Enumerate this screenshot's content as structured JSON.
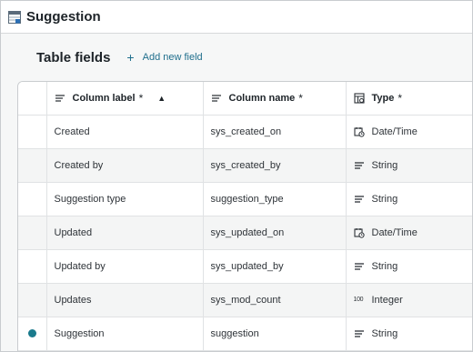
{
  "window": {
    "title": "Suggestion",
    "icon": "table-icon"
  },
  "section": {
    "heading": "Table fields",
    "add_label": "Add new field",
    "add_icon": "plus-icon"
  },
  "columns": {
    "label": {
      "text": "Column label",
      "required": "*",
      "sort": "▲"
    },
    "name": {
      "text": "Column name",
      "required": "*"
    },
    "type": {
      "text": "Type",
      "required": "*"
    }
  },
  "rows": [
    {
      "label": "Created",
      "name": "sys_created_on",
      "type": "Date/Time",
      "type_icon": "calendar-clock-icon",
      "marker": ""
    },
    {
      "label": "Created by",
      "name": "sys_created_by",
      "type": "String",
      "type_icon": "text-lines-icon",
      "marker": ""
    },
    {
      "label": "Suggestion type",
      "name": "suggestion_type",
      "type": "String",
      "type_icon": "text-lines-icon",
      "marker": ""
    },
    {
      "label": "Updated",
      "name": "sys_updated_on",
      "type": "Date/Time",
      "type_icon": "calendar-clock-icon",
      "marker": ""
    },
    {
      "label": "Updated by",
      "name": "sys_updated_by",
      "type": "String",
      "type_icon": "text-lines-icon",
      "marker": ""
    },
    {
      "label": "Updates",
      "name": "sys_mod_count",
      "type": "Integer",
      "type_icon": "integer-icon",
      "integer_glyph": "100",
      "marker": ""
    },
    {
      "label": "Suggestion",
      "name": "suggestion",
      "type": "String",
      "type_icon": "text-lines-icon",
      "marker": "display-dot"
    }
  ],
  "colors": {
    "accent": "#1f6e8c",
    "dot": "#1a7a8c",
    "border": "#c9cccf"
  }
}
